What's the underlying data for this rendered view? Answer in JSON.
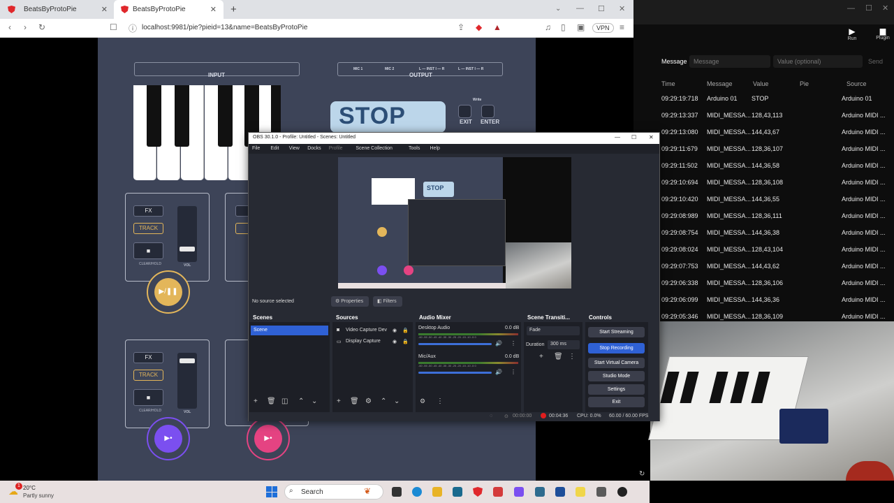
{
  "browser": {
    "tabs": [
      {
        "label": "BeatsByProtoPie"
      },
      {
        "label": "BeatsByProtoPie"
      }
    ],
    "url": "localhost:9981/pie?pieid=13&name=BeatsByProtoPie",
    "vpn_label": "VPN"
  },
  "pie": {
    "input_label": "INPUT",
    "output_label": "OUTPUT",
    "output_channels": [
      "MIC 1",
      "MIC 2",
      "L — INST I — R",
      "L — INST I — R"
    ],
    "stop_label": "STOP",
    "write_label": "Write",
    "exit_label": "EXIT",
    "enter_label": "ENTER",
    "fx_label": "FX",
    "track_label": "TRACK",
    "clear_hold_label": "CLEAR/HOLD",
    "vol_label": "VOL"
  },
  "monitor": {
    "run_label": "Run",
    "plugin_label": "Plugin",
    "message_label": "Message",
    "message_placeholder": "Message",
    "value_placeholder": "Value (optional)",
    "send_label": "Send",
    "columns": [
      "Time",
      "Message",
      "Value",
      "Pie",
      "Source"
    ],
    "rows": [
      [
        "09:29:19:718",
        "Arduino 01",
        "STOP",
        "",
        "Arduino 01"
      ],
      [
        "09:29:13:337",
        "MIDI_MESSA...",
        "128,43,113",
        "",
        "Arduino MIDI ..."
      ],
      [
        "09:29:13:080",
        "MIDI_MESSA...",
        "144,43,67",
        "",
        "Arduino MIDI ..."
      ],
      [
        "09:29:11:679",
        "MIDI_MESSA...",
        "128,36,107",
        "",
        "Arduino MIDI ..."
      ],
      [
        "09:29:11:502",
        "MIDI_MESSA...",
        "144,36,58",
        "",
        "Arduino MIDI ..."
      ],
      [
        "09:29:10:694",
        "MIDI_MESSA...",
        "128,36,108",
        "",
        "Arduino MIDI ..."
      ],
      [
        "09:29:10:420",
        "MIDI_MESSA...",
        "144,36,55",
        "",
        "Arduino MIDI ..."
      ],
      [
        "09:29:08:989",
        "MIDI_MESSA...",
        "128,36,111",
        "",
        "Arduino MIDI ..."
      ],
      [
        "09:29:08:754",
        "MIDI_MESSA...",
        "144,36,38",
        "",
        "Arduino MIDI ..."
      ],
      [
        "09:29:08:024",
        "MIDI_MESSA...",
        "128,43,104",
        "",
        "Arduino MIDI ..."
      ],
      [
        "09:29:07:753",
        "MIDI_MESSA...",
        "144,43,62",
        "",
        "Arduino MIDI ..."
      ],
      [
        "09:29:06:338",
        "MIDI_MESSA...",
        "128,36,106",
        "",
        "Arduino MIDI ..."
      ],
      [
        "09:29:06:099",
        "MIDI_MESSA...",
        "144,36,36",
        "",
        "Arduino MIDI ..."
      ],
      [
        "09:29:05:346",
        "MIDI_MESSA...",
        "128,36,109",
        "",
        "Arduino MIDI ..."
      ]
    ]
  },
  "obs": {
    "title": "OBS 30.1.0 - Profile: Untitled - Scenes: Untitled",
    "menu": [
      "File",
      "Edit",
      "View",
      "Docks",
      "Profile",
      "Scene Collection",
      "Tools",
      "Help"
    ],
    "no_source": "No source selected",
    "properties_label": "Properties",
    "filters_label": "Filters",
    "scenes_title": "Scenes",
    "scenes": [
      "Scene"
    ],
    "sources_title": "Sources",
    "sources": [
      "Video Capture Dev",
      "Display Capture"
    ],
    "mixer_title": "Audio Mixer",
    "mixer": [
      {
        "name": "Desktop Audio",
        "db": "0.0 dB"
      },
      {
        "name": "Mic/Aux",
        "db": "0.0 dB"
      }
    ],
    "meter_scale": "-60 -55 -50 -45 -40 -35 -30 -25 -20 -15 -10 -5 0",
    "transition_title": "Scene Transiti...",
    "transition": "Fade",
    "duration_label": "Duration",
    "duration_value": "300 ms",
    "controls_title": "Controls",
    "controls": [
      "Start Streaming",
      "Stop Recording",
      "Start Virtual Camera",
      "Studio Mode",
      "Settings",
      "Exit"
    ],
    "status": {
      "stream_time": "00:00:00",
      "rec_time": "00:04:36",
      "cpu": "CPU: 0.0%",
      "fps": "60.00 / 60.00 FPS"
    }
  },
  "taskbar": {
    "weather_temp": "20°C",
    "weather_desc": "Partly sunny",
    "search_label": "Search"
  },
  "colors": {
    "pie_bg": "#3d4458",
    "stop_bg": "#bcd6ea",
    "accent_gold": "#e3b65a",
    "accent_purple": "#7b4ff0",
    "accent_pink": "#e54382",
    "obs_blue": "#2f61d5",
    "record_red": "#e01e1e"
  }
}
